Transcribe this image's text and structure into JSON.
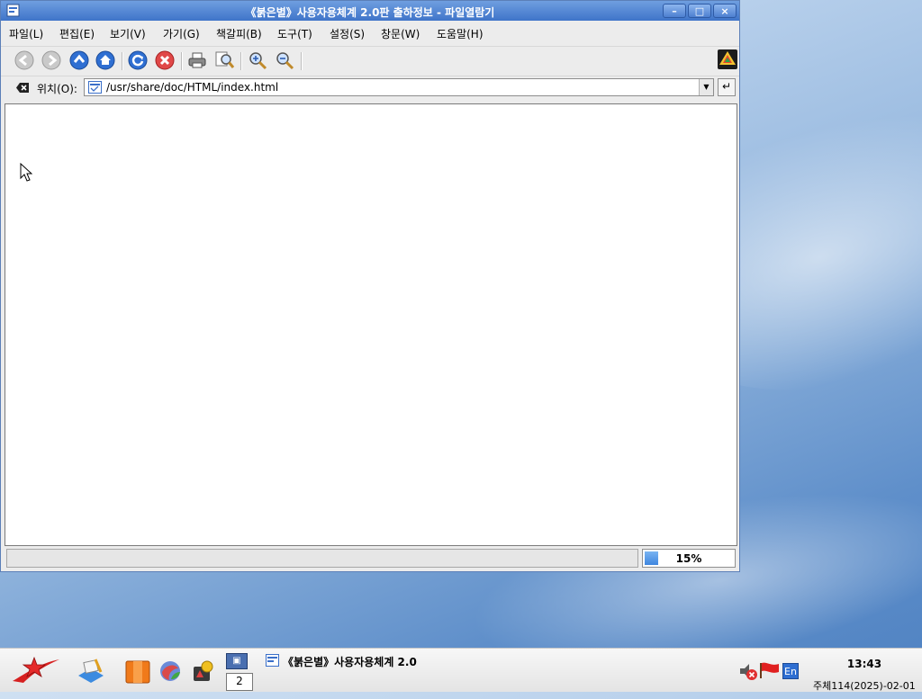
{
  "window": {
    "title": "《붉은별》사용자용체계 2.0판 출하정보 - 파일열람기",
    "minimize_label": "–",
    "maximize_label": "□",
    "close_label": "×"
  },
  "menu": {
    "items": [
      "파일(L)",
      "편집(E)",
      "보기(V)",
      "가기(G)",
      "책갈피(B)",
      "도구(T)",
      "설정(S)",
      "창문(W)",
      "도움말(H)"
    ]
  },
  "toolbar": {
    "icons": [
      "back-icon",
      "forward-icon",
      "up-icon",
      "home-icon",
      "reload-icon",
      "stop-icon",
      "print-icon",
      "find-icon",
      "zoom-in-icon",
      "zoom-out-icon",
      "app-logo-icon"
    ]
  },
  "location": {
    "label": "위치(O):",
    "value": "/usr/share/doc/HTML/index.html"
  },
  "status": {
    "text": "",
    "progress_label": "15%",
    "progress_value": 0.15
  },
  "taskbar": {
    "pager_number": "2",
    "task_label": "《붉은별》사용자용체계 2.0",
    "clock": "13:43",
    "date": "주체114(2025)-02-01",
    "keyboard_layout": "En"
  },
  "colors": {
    "titlebar": "#3f74c9",
    "progress": "#3f86df"
  }
}
